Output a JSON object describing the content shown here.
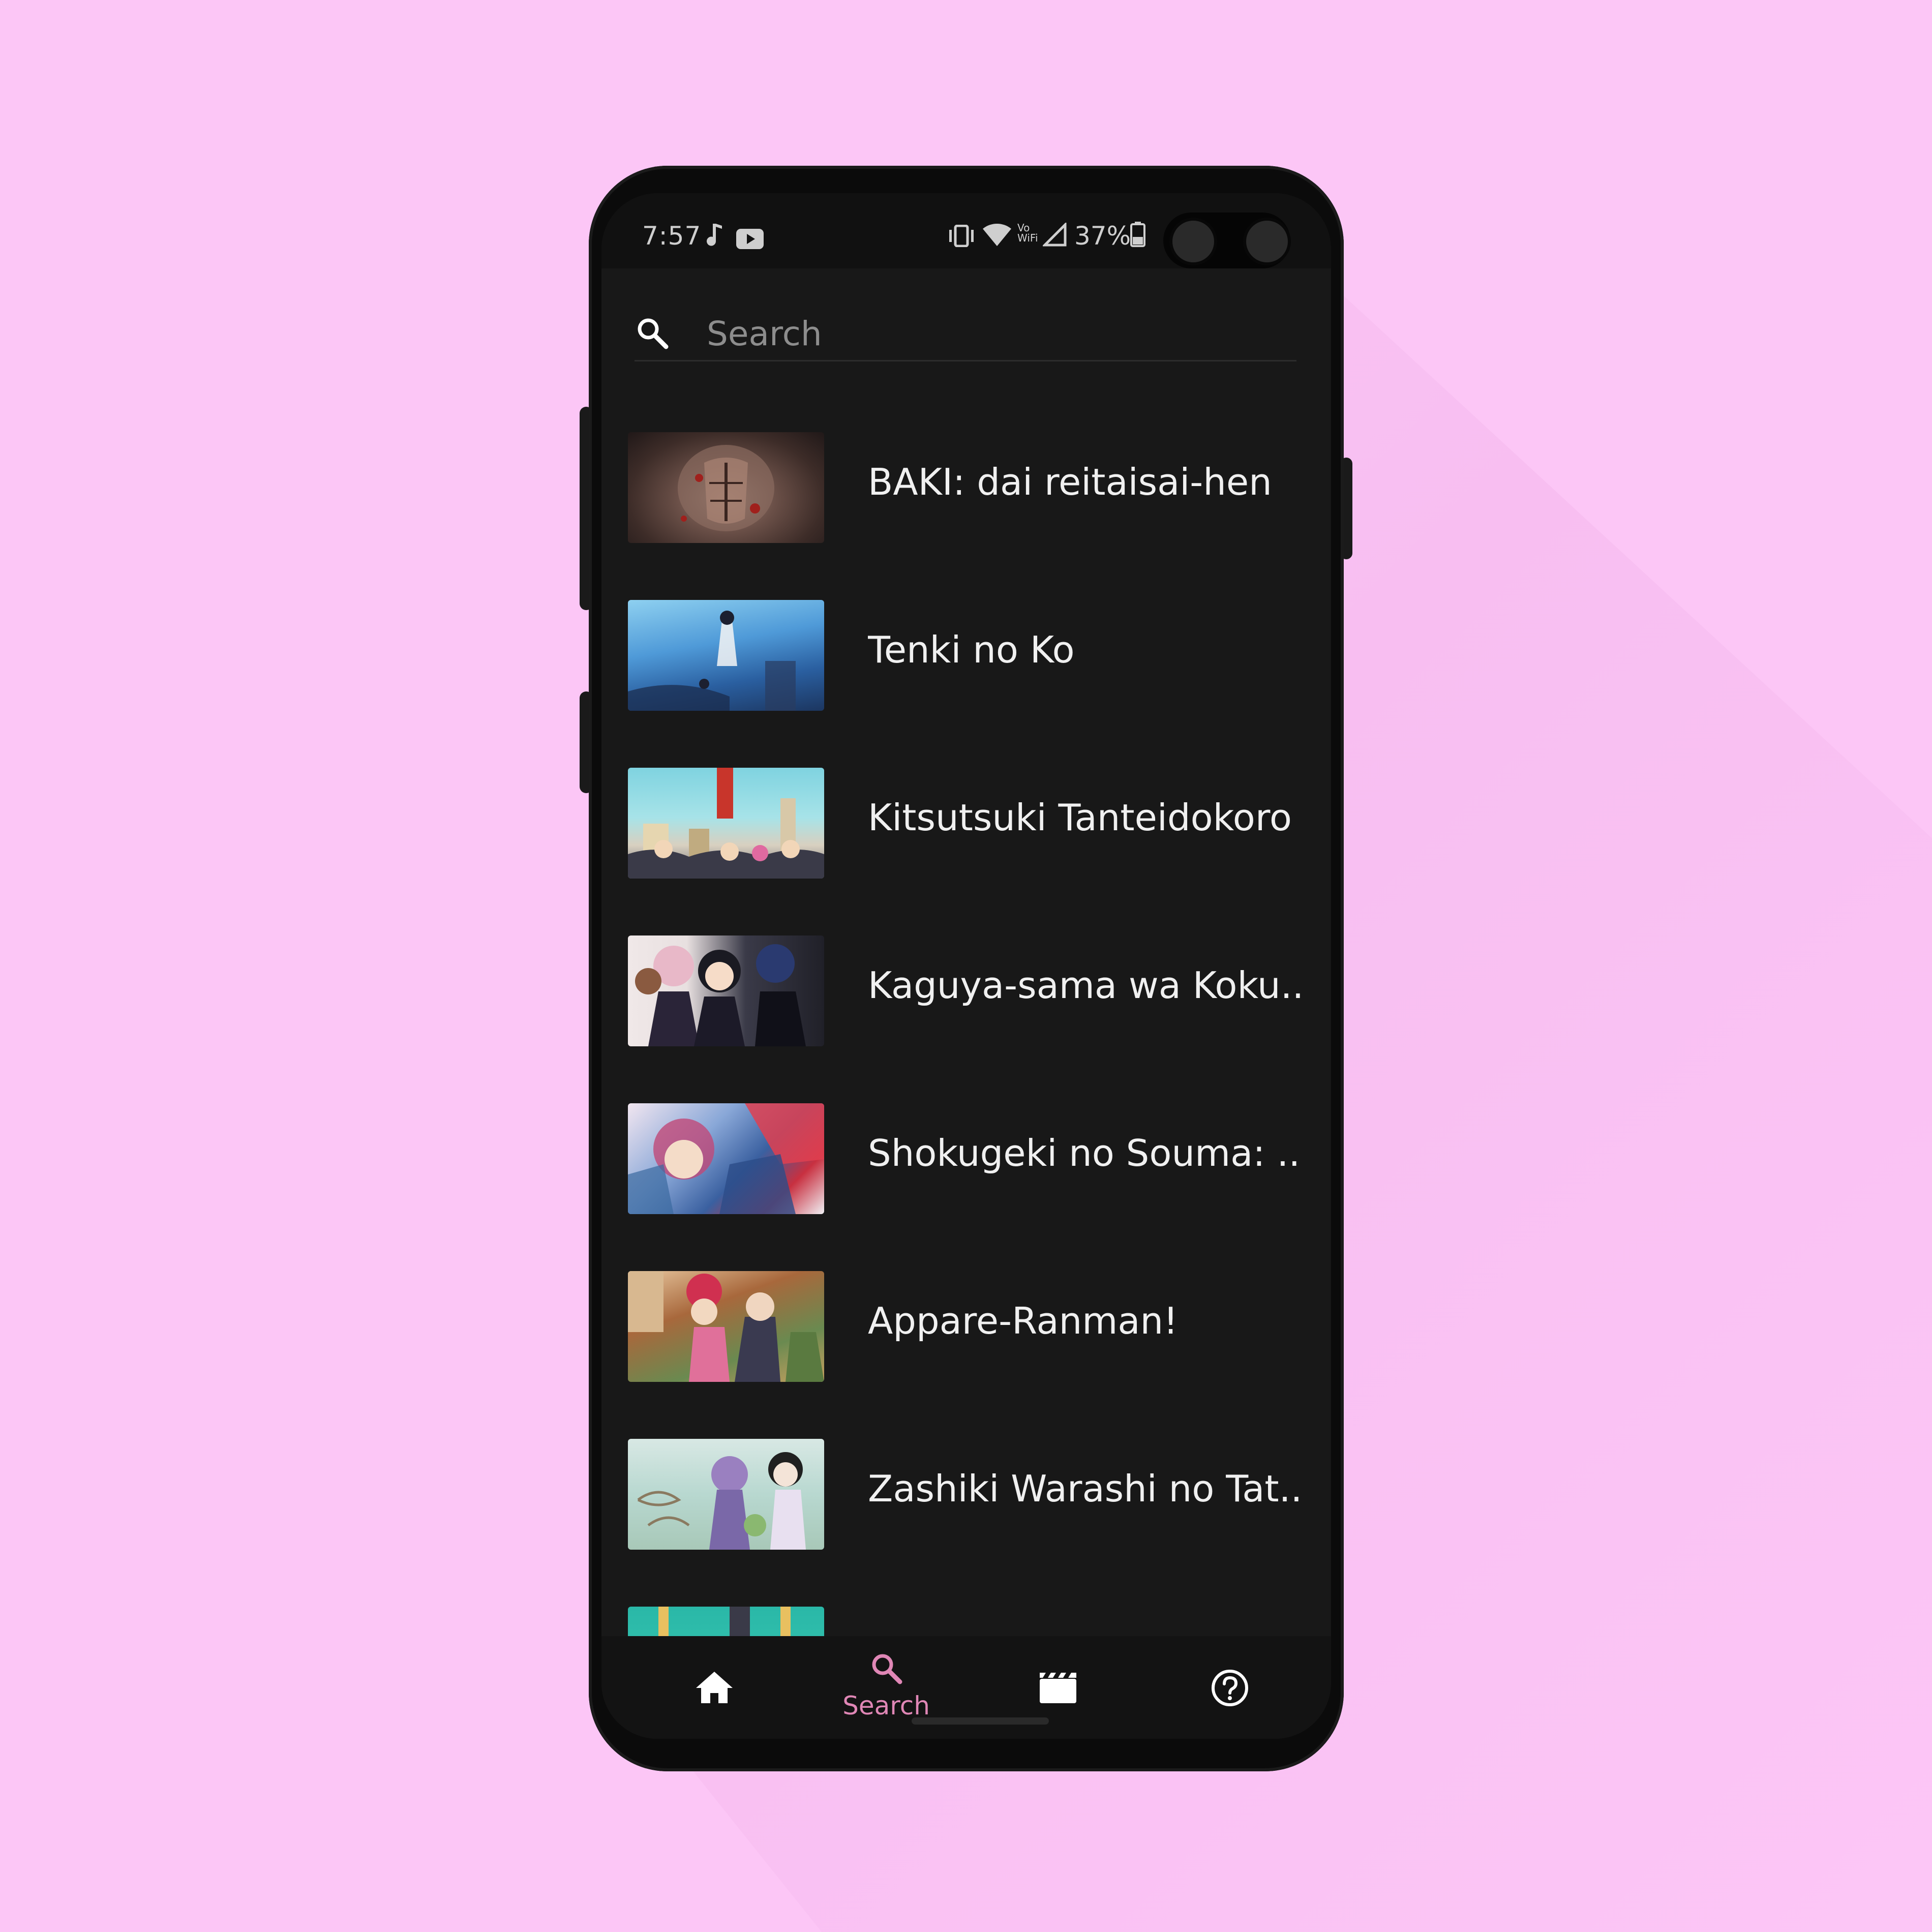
{
  "colors": {
    "background": "#fcc6f6",
    "screen_bg": "#181818",
    "accent": "#e087b6",
    "text": "#f0f0f0"
  },
  "status_bar": {
    "time": "7:57",
    "battery": "37%",
    "icons": [
      "music-note-icon",
      "youtube-icon",
      "vibrate-icon",
      "wifi-icon",
      "vowifi-icon",
      "signal-icon",
      "battery-icon"
    ],
    "vowifi_label": "Vo WiFi"
  },
  "search": {
    "placeholder": "Search",
    "value": ""
  },
  "results": [
    {
      "title": "BAKI: dai reitaisai-hen"
    },
    {
      "title": "Tenki no Ko"
    },
    {
      "title": "Kitsutsuki Tanteidokoro"
    },
    {
      "title": "Kaguya-sama wa Koku..."
    },
    {
      "title": "Shokugeki no Souma: ..."
    },
    {
      "title": "Appare-Ranman!"
    },
    {
      "title": "Zashiki Warashi no Tat..."
    },
    {
      "title": ""
    }
  ],
  "bottom_nav": {
    "items": [
      {
        "icon": "home-icon",
        "label": "",
        "active": false
      },
      {
        "icon": "search-icon",
        "label": "Search",
        "active": true
      },
      {
        "icon": "movie-icon",
        "label": "",
        "active": false
      },
      {
        "icon": "help-icon",
        "label": "",
        "active": false
      }
    ]
  }
}
